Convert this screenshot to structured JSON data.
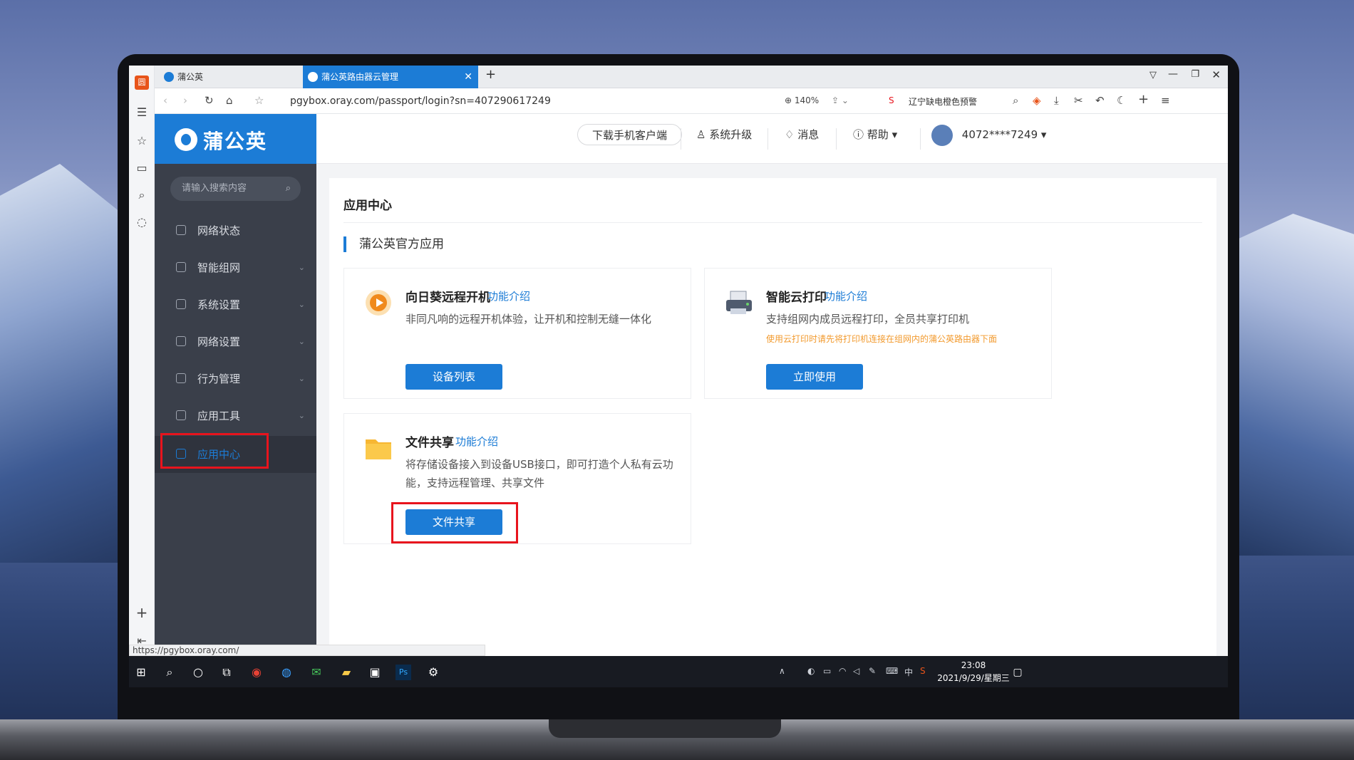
{
  "browser": {
    "tabs": [
      {
        "label": "蒲公英"
      },
      {
        "label": "蒲公英路由器云管理"
      }
    ],
    "url": "pgybox.oray.com/passport/login?sn=407290617249",
    "zoom": "140%",
    "news": "辽宁缺电橙色预警",
    "status_url": "https://pgybox.oray.com/"
  },
  "app": {
    "logo": "蒲公英",
    "header": {
      "download": "下载手机客户端",
      "upgrade": "系统升级",
      "message": "消息",
      "help": "帮助",
      "user": "4072****7249"
    },
    "search_placeholder": "请输入搜索内容",
    "nav": [
      {
        "label": "网络状态"
      },
      {
        "label": "智能组网"
      },
      {
        "label": "系统设置"
      },
      {
        "label": "网络设置"
      },
      {
        "label": "行为管理"
      },
      {
        "label": "应用工具"
      },
      {
        "label": "应用中心"
      }
    ],
    "page_title": "应用中心",
    "section_title": "蒲公英官方应用",
    "cards": [
      {
        "title": "向日葵远程开机",
        "link": "功能介绍",
        "desc": "非同凡响的远程开机体验，让开机和控制无缝一体化",
        "button": "设备列表"
      },
      {
        "title": "智能云打印",
        "link": "功能介绍",
        "desc": "支持组网内成员远程打印，全员共享打印机",
        "warn": "使用云打印时请先将打印机连接在组网内的蒲公英路由器下面",
        "button": "立即使用"
      },
      {
        "title": "文件共享",
        "link": "功能介绍",
        "desc": "将存储设备接入到设备USB接口，即可打造个人私有云功能，支持远程管理、共享文件",
        "button": "文件共享"
      }
    ]
  },
  "taskbar": {
    "time": "23:08",
    "date": "2021/9/29/星期三",
    "ime": "中"
  },
  "colors": {
    "accent": "#1c7cd6",
    "highlight": "#e8141d",
    "sidebar": "#3a3f4a",
    "warning": "#f29a2e"
  }
}
